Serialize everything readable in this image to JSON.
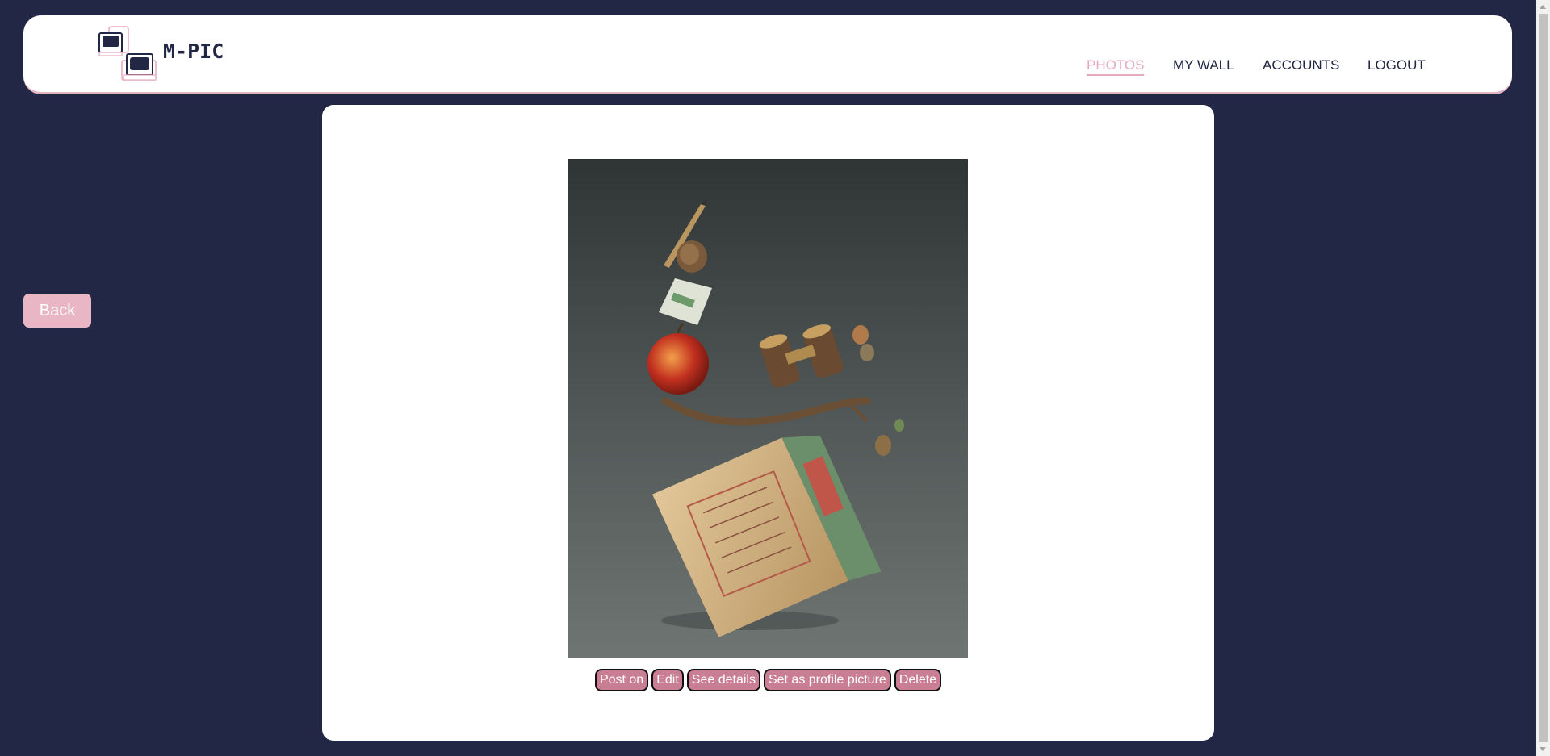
{
  "brand": {
    "name": "M-PIC",
    "logo_icon": "computers-logo-icon"
  },
  "nav": {
    "items": [
      {
        "label": "PHOTOS",
        "active": true
      },
      {
        "label": "MY WALL",
        "active": false
      },
      {
        "label": "ACCOUNTS",
        "active": false
      },
      {
        "label": "LOGOUT",
        "active": false
      }
    ]
  },
  "back_label": "Back",
  "photo": {
    "icon": "balanced-objects-photo"
  },
  "actions": {
    "post_on": "Post on",
    "edit": "Edit",
    "see_details": "See details",
    "set_profile": "Set as profile picture",
    "delete": "Delete"
  },
  "colors": {
    "background": "#232746",
    "accent_pink": "#e6a9bd",
    "action_button": "#c97e94"
  }
}
